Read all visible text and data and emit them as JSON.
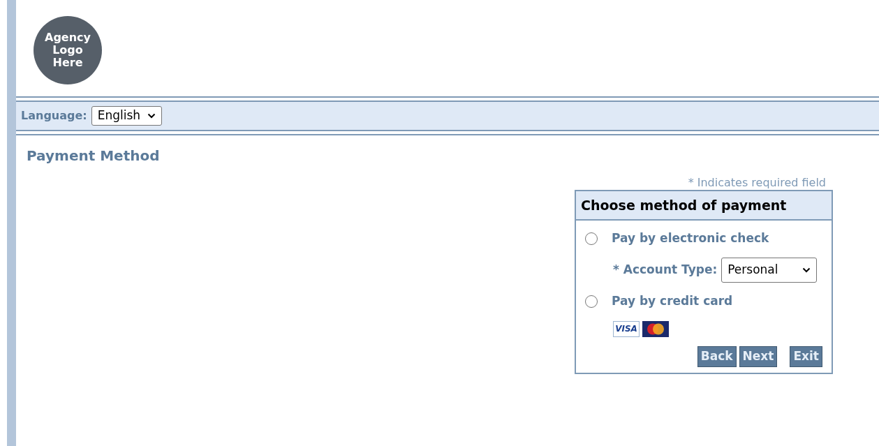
{
  "logo": {
    "lines": [
      "Agency",
      "Logo",
      "Here"
    ]
  },
  "language": {
    "label": "Language:",
    "value": "English"
  },
  "page_title": "Payment Method",
  "required_note": "* Indicates required field",
  "panel": {
    "title": "Choose method of payment",
    "options": [
      {
        "label": "Pay by electronic check",
        "selected": false,
        "field": {
          "label": "* Account Type:",
          "value": "Personal"
        }
      },
      {
        "label": "Pay by credit card",
        "selected": false,
        "cards": [
          {
            "kind": "visa",
            "text": "VISA"
          },
          {
            "kind": "mastercard"
          }
        ]
      }
    ],
    "buttons": [
      "Back",
      "Next",
      "Exit"
    ]
  }
}
